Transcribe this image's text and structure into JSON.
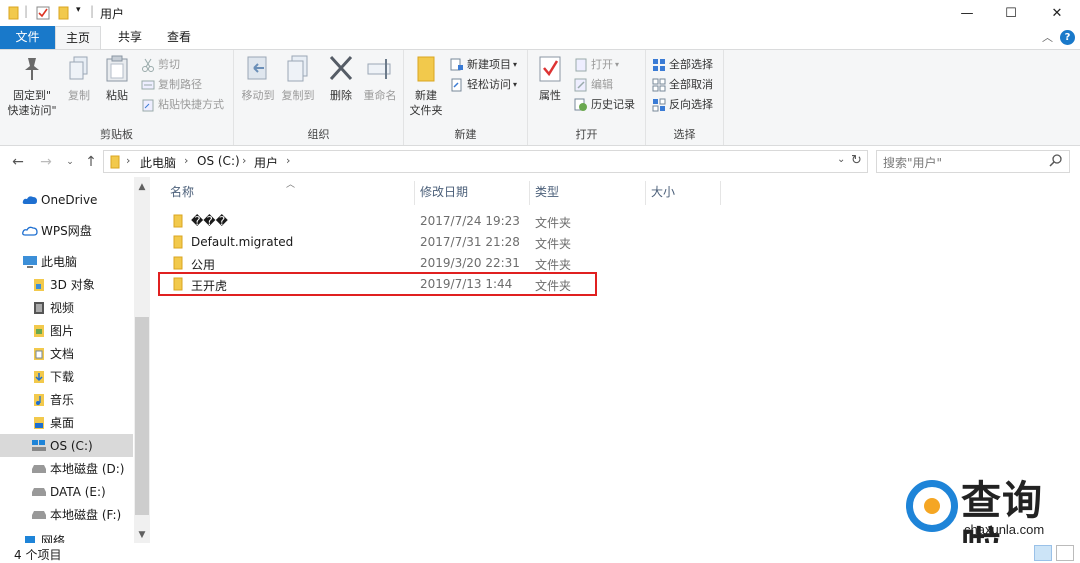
{
  "window": {
    "title": "用户",
    "minimize": "—",
    "maximize": "☐",
    "close": "✕"
  },
  "tabs": {
    "file": "文件",
    "home": "主页",
    "share": "共享",
    "view": "查看"
  },
  "ribbon": {
    "clipboard": {
      "label": "剪贴板",
      "pin": "固定到\"快速访问\"",
      "pin_l1": "固定到\"",
      "pin_l2": "快速访问\"",
      "copy": "复制",
      "paste": "粘贴",
      "cut": "剪切",
      "copy_path": "复制路径",
      "paste_shortcut": "粘贴快捷方式"
    },
    "organize": {
      "label": "组织",
      "move_to": "移动到",
      "copy_to": "复制到",
      "delete": "删除",
      "rename": "重命名"
    },
    "new": {
      "label": "新建",
      "new_folder_l1": "新建",
      "new_folder_l2": "文件夹",
      "new_item": "新建项目",
      "easy_access": "轻松访问"
    },
    "open": {
      "label": "打开",
      "properties": "属性",
      "open": "打开",
      "edit": "编辑",
      "history": "历史记录"
    },
    "select": {
      "label": "选择",
      "select_all": "全部选择",
      "select_none": "全部取消",
      "invert": "反向选择"
    }
  },
  "address": {
    "crumbs": [
      "此电脑",
      "OS (C:)",
      "用户"
    ],
    "search_placeholder": "搜索\"用户\""
  },
  "navpane": {
    "items": [
      {
        "label": "OneDrive",
        "icon": "cloud-icon"
      },
      {
        "label": "WPS网盘",
        "icon": "cloud-outline-icon"
      },
      {
        "label": "此电脑",
        "icon": "computer-icon"
      },
      {
        "label": "3D 对象",
        "icon": "3d-objects-icon"
      },
      {
        "label": "视频",
        "icon": "video-icon"
      },
      {
        "label": "图片",
        "icon": "pictures-icon"
      },
      {
        "label": "文档",
        "icon": "documents-icon"
      },
      {
        "label": "下载",
        "icon": "download-icon"
      },
      {
        "label": "音乐",
        "icon": "music-icon"
      },
      {
        "label": "桌面",
        "icon": "desktop-icon"
      },
      {
        "label": "OS (C:)",
        "icon": "drive-c-icon"
      },
      {
        "label": "本地磁盘 (D:)",
        "icon": "drive-icon"
      },
      {
        "label": "DATA (E:)",
        "icon": "drive-icon"
      },
      {
        "label": "本地磁盘 (F:)",
        "icon": "drive-icon"
      },
      {
        "label": "网络",
        "icon": "network-icon"
      }
    ]
  },
  "filelist": {
    "columns": {
      "name": "名称",
      "date": "修改日期",
      "type": "类型",
      "size": "大小"
    },
    "rows": [
      {
        "name": "���",
        "date": "2017/7/24 19:23",
        "type": "文件夹"
      },
      {
        "name": "Default.migrated",
        "date": "2017/7/31 21:28",
        "type": "文件夹"
      },
      {
        "name": "公用",
        "date": "2019/3/20 22:31",
        "type": "文件夹"
      },
      {
        "name": "王开虎",
        "date": "2019/7/13 1:44",
        "type": "文件夹"
      }
    ]
  },
  "status": {
    "count": "4 个项目"
  },
  "watermark": {
    "text": "查询啦",
    "url": "chaxunla.com"
  },
  "colors": {
    "accent": "#1979ca",
    "folder": "#f2c94c",
    "highlight": "#e02020"
  }
}
